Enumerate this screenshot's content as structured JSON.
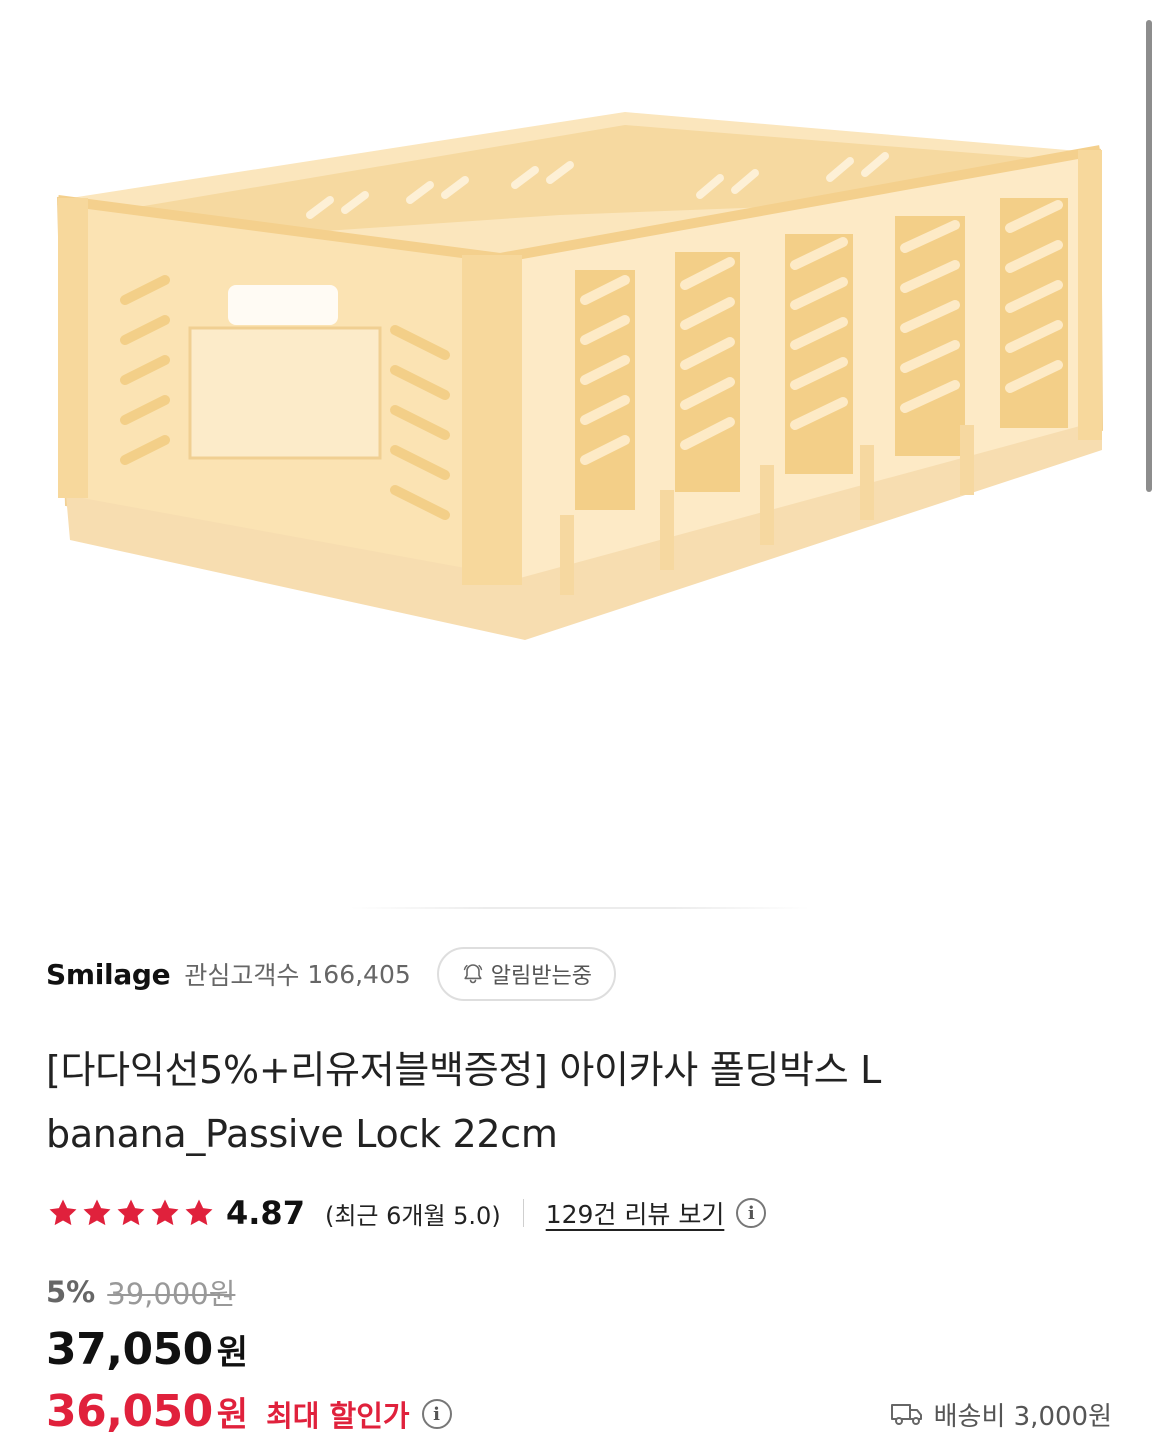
{
  "product_image": {
    "alt": "banana yellow folding crate"
  },
  "seller": {
    "name": "Smilage",
    "follower_label": "관심고객수",
    "follower_count": "166,405",
    "notify_label": "알림받는중",
    "notify_icon": "bell-icon"
  },
  "product": {
    "title_line1": "[다다익선5%+리유저블백증정] 아이카사 폴딩박스 L",
    "title_line2": "banana_Passive Lock 22cm"
  },
  "rating": {
    "stars_filled": 5,
    "star_color": "#e0213c",
    "value": "4.87",
    "recent": "(최근 6개월 5.0)",
    "review_link": "129건 리뷰 보기",
    "info_icon": "info-icon"
  },
  "price": {
    "discount_rate": "5%",
    "original": "39,000원",
    "sale_amount": "37,050",
    "sale_unit": "원",
    "max_amount": "36,050",
    "max_unit": "원",
    "max_label": "최대 할인가",
    "accent_color": "#e0213c"
  },
  "shipping": {
    "icon": "truck-icon",
    "text": "배송비 3,000원"
  }
}
